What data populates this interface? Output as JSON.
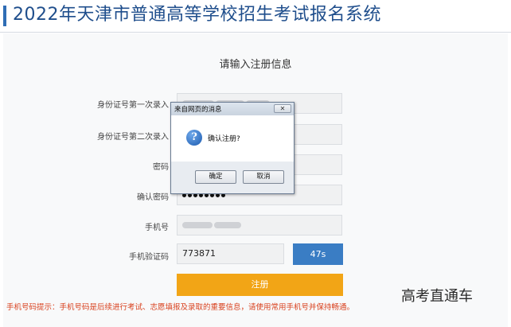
{
  "header": {
    "title": "2022年天津市普通高等学校招生考试报名系统"
  },
  "form": {
    "title": "请输入注册信息",
    "fields": [
      {
        "label": "身份证号第一次录入"
      },
      {
        "label": "身份证号第二次录入"
      },
      {
        "label": "密码"
      },
      {
        "label": "确认密码"
      },
      {
        "label": "手机号"
      },
      {
        "label": "手机验证码",
        "value": "773871"
      }
    ],
    "countdown_label": "47s",
    "submit_label": "注册",
    "hint": "手机号码提示：手机号码是后续进行考试、志愿填报及录取的重要信息，请使用常用手机号并保持畅通。"
  },
  "dialog": {
    "title": "来自网页的消息",
    "close_label": "✕",
    "icon": "question-icon",
    "icon_glyph": "?",
    "message": "确认注册?",
    "ok_label": "确定",
    "cancel_label": "取消"
  },
  "watermark": "高考直通车"
}
